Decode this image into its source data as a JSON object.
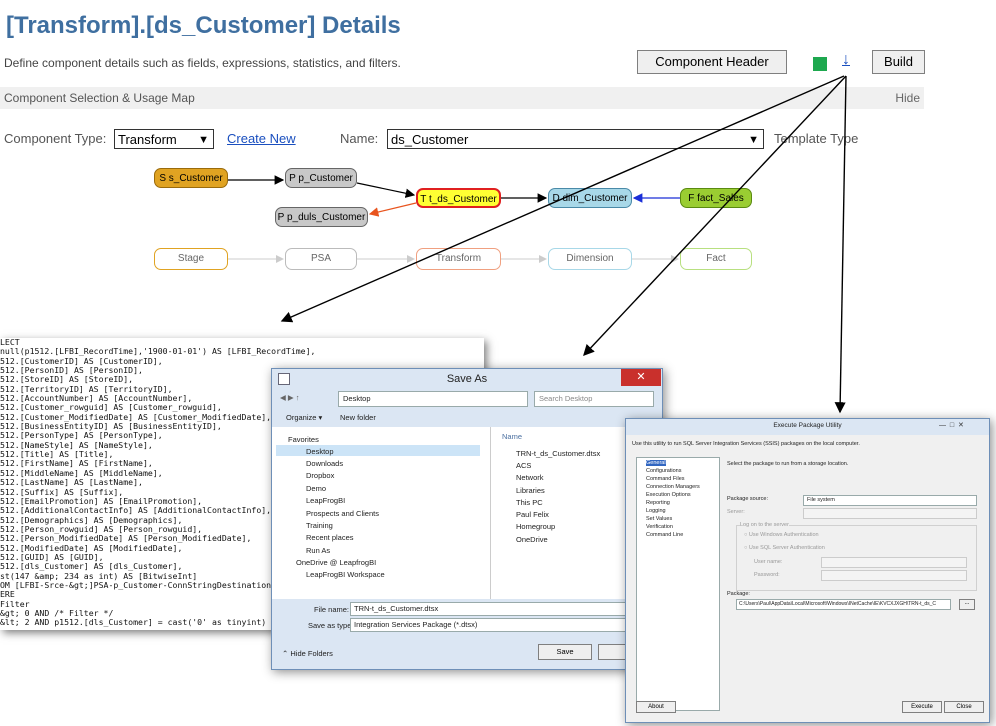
{
  "page": {
    "title": "[Transform].[ds_Customer] Details",
    "description": "Define component details such as fields, expressions, statistics, and filters.",
    "component_header_button": "Component Header",
    "download_icon": "↓",
    "build_button": "Build",
    "status_color": "#1ea84f"
  },
  "section": {
    "title": "Component Selection & Usage Map",
    "toggle": "Hide"
  },
  "form": {
    "type_label": "Component Type:",
    "type_value": "Transform",
    "create_new": "Create New",
    "name_label": "Name:",
    "name_value": "ds_Customer",
    "template_label": "Template Type"
  },
  "graph": {
    "nodes": {
      "s_customer": "S s_Customer",
      "p_customer": "P p_Customer",
      "t_ds_customer": "T t_ds_Customer",
      "d_dim_customer": "D dim_Customer",
      "f_fact_sales": "F fact_Sales",
      "p_duls_customer": "P p_duls_Customer"
    },
    "lanes": [
      "Stage",
      "PSA",
      "Transform",
      "Dimension",
      "Fact"
    ]
  },
  "code_lines": [
    "LECT",
    "null(p1512.[LFBI_RecordTime],'1900-01-01') AS [LFBI_RecordTime],",
    "512.[CustomerID] AS [CustomerID],",
    "512.[PersonID] AS [PersonID],",
    "512.[StoreID] AS [StoreID],",
    "512.[TerritoryID] AS [TerritoryID],",
    "512.[AccountNumber] AS [AccountNumber],",
    "512.[Customer_rowguid] AS [Customer_rowguid],",
    "512.[Customer_ModifiedDate] AS [Customer_ModifiedDate],",
    "512.[BusinessEntityID] AS [BusinessEntityID],",
    "512.[PersonType] AS [PersonType],",
    "512.[NameStyle] AS [NameStyle],",
    "512.[Title] AS [Title],",
    "512.[FirstName] AS [FirstName],",
    "512.[MiddleName] AS [MiddleName],",
    "512.[LastName] AS [LastName],",
    "512.[Suffix] AS [Suffix],",
    "512.[EmailPromotion] AS [EmailPromotion],",
    "512.[AdditionalContactInfo] AS [AdditionalContactInfo],",
    "512.[Demographics] AS [Demographics],",
    "512.[Person_rowguid] AS [Person_rowguid],",
    "512.[Person_ModifiedDate] AS [Person_ModifiedDate],",
    "512.[ModifiedDate] AS [ModifiedDate],",
    "512.[GUID] AS [GUID],",
    "512.[dls_Customer] AS [dls_Customer],",
    "st(147 &amp; 234 as int) AS [BitwiseInt]",
    "OM [LFBI-Srce-&gt;]PSA-p_Customer-ConnStringDestination",
    "ERE",
    "Filter",
    "&gt; 0 AND /* Filter */",
    "&lt; 2 AND p1512.[dls_Customer] = cast('0' as tinyint)"
  ],
  "save_as": {
    "title": "Save As",
    "path": "Desktop",
    "search_placeholder": "Search Desktop",
    "organize": "Organize ▾",
    "new_folder": "New folder",
    "nav": [
      "Favorites",
      "Desktop",
      "Downloads",
      "Dropbox",
      "Demo",
      "LeapFrogBI",
      "Prospects and Clients",
      "Training",
      "Recent places",
      "Run As",
      "OneDrive @ LeapfrogBI",
      "LeapFrogBI Workspace"
    ],
    "column_name": "Name",
    "files": [
      "TRN-t_ds_Customer.dtsx",
      "ACS",
      "Network",
      "Libraries",
      "This PC",
      "Paul Felix",
      "Homegroup",
      "OneDrive"
    ],
    "file_name_label": "File name:",
    "file_name_value": "TRN-t_ds_Customer.dtsx",
    "save_type_label": "Save as type:",
    "save_type_value": "Integration Services Package (*.dtsx)",
    "hide_folders": "Hide Folders",
    "save_button": "Save",
    "cancel_button": "Can"
  },
  "epu": {
    "title": "Execute Package Utility",
    "intro": "Use this utility to run SQL Server Integration Services (SSIS) packages on the local computer.",
    "nav": [
      "General",
      "Configurations",
      "Command Files",
      "Connection Managers",
      "Execution Options",
      "Reporting",
      "Logging",
      "Set Values",
      "Verification",
      "Command Line"
    ],
    "select_text": "Select the package to run from a storage location.",
    "source_label": "Package source:",
    "source_value": "File system",
    "server_label": "Server:",
    "logon_label": "Log on to the server",
    "win_auth": "Use Windows Authentication",
    "sql_auth": "Use SQL Server Authentication",
    "user_label": "User name:",
    "password_label": "Password:",
    "package_label": "Package:",
    "package_value": "C:\\Users\\Paul\\AppData\\Local\\Microsoft\\Windows\\INetCache\\IE\\KVCXJXGH\\TRN-t_ds_C",
    "browse": "...",
    "about": "About",
    "execute": "Execute",
    "close": "Close"
  }
}
